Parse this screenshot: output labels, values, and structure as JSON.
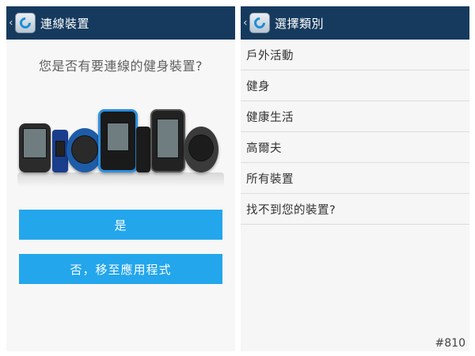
{
  "left_screen": {
    "title": "連線裝置",
    "question": "您是否有要連線的健身裝置?",
    "yes_button": "是",
    "no_button": "否，移至應用程式"
  },
  "right_screen": {
    "title": "選擇類別",
    "categories": [
      "戶外活動",
      "健身",
      "健康生活",
      "高爾夫",
      "所有裝置",
      "找不到您的裝置?"
    ]
  },
  "watermark": "#810",
  "colors": {
    "appbar": "#163a5e",
    "button": "#23a6ec"
  },
  "icons": [
    "back-chevron-icon",
    "garmin-connect-app-icon"
  ]
}
